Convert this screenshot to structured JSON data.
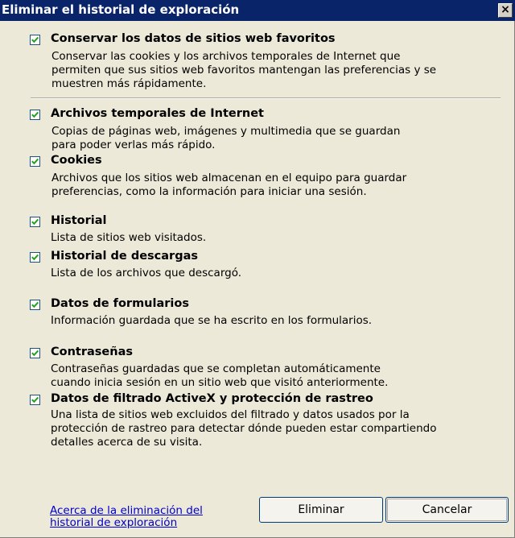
{
  "window": {
    "title": "Eliminar el historial de exploración",
    "close_glyph": "×"
  },
  "options": [
    {
      "checked": true,
      "title": "Conservar los datos de sitios web favoritos",
      "desc": "Conservar las cookies y los archivos temporales de Internet que\npermiten que sus sitios web favoritos mantengan las preferencias y se\nmuestren más rápidamente."
    },
    {
      "checked": true,
      "title": "Archivos temporales de Internet",
      "desc": "Copias de páginas web, imágenes y multimedia que se guardan\npara poder verlas más rápido."
    },
    {
      "checked": true,
      "title": "Cookies",
      "desc": "Archivos que los sitios web almacenan en el equipo para guardar\npreferencias, como la información para iniciar una sesión."
    },
    {
      "checked": true,
      "title": "Historial",
      "desc": "Lista de sitios web visitados."
    },
    {
      "checked": true,
      "title": "Historial de descargas",
      "desc": "Lista de los archivos que descargó."
    },
    {
      "checked": true,
      "title": "Datos de formularios",
      "desc": "Información guardada que se ha escrito en los formularios."
    },
    {
      "checked": true,
      "title": "Contraseñas",
      "desc": "Contraseñas guardadas que se completan automáticamente\ncuando inicia sesión en un sitio web que visitó anteriormente."
    },
    {
      "checked": true,
      "title": "Datos de filtrado ActiveX y protección de rastreo",
      "desc": "Una lista de sitios web excluidos del filtrado y datos usados por la\nprotección de rastreo para detectar dónde pueden estar compartiendo\ndetalles acerca de su visita."
    }
  ],
  "footer": {
    "about_link": "Acerca de la eliminación del\nhistorial de exploración",
    "delete_label": "Eliminar",
    "cancel_label": "Cancelar"
  },
  "icons": {
    "checkbox_check": "checkmark-icon",
    "close": "close-icon"
  },
  "colors": {
    "titlebar": "#0a246a",
    "dialog_bg": "#ece9d8",
    "link": "#0000cc",
    "checkbox_border": "#1c5180"
  }
}
